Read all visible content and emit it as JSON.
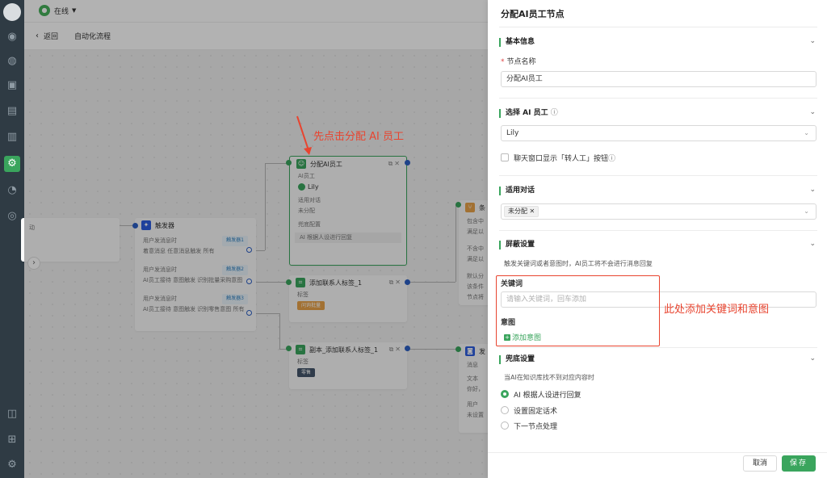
{
  "topbar": {
    "status": "在线"
  },
  "subbar": {
    "back": "返回",
    "breadcrumb": "自动化流程"
  },
  "canvas": {
    "left_node_stub": "动",
    "trigger": {
      "title": "触发器",
      "rows": [
        {
          "event": "用户发消息时",
          "tag": "触发器1",
          "detail": "着意消息  任意消息触发  所有"
        },
        {
          "event": "用户发消息时",
          "tag": "触发器2",
          "detail": "AI员工接待  意图触发  识别批量采购意图"
        },
        {
          "event": "用户发消息时",
          "tag": "触发器3",
          "detail": "AI员工接待  意图触发  识别零售意图  所有"
        }
      ]
    },
    "assign_node": {
      "title": "分配AI员工",
      "ai_label": "AI员工",
      "ai_value": "Lily",
      "scope_label": "适用对话",
      "scope_value": "未分配",
      "fallback_label": "兜底配置",
      "fallback_value": "AI 根据人设进行回复"
    },
    "tag_node_1": {
      "title": "添加联系人标签_1",
      "label": "标签",
      "tag": "问询批量"
    },
    "tag_node_2": {
      "title": "副本_添加联系人标签_1",
      "label": "标签",
      "tag": "零售"
    },
    "cond_node": {
      "title": "条",
      "rows": [
        "包含中",
        "满足以",
        "不含中",
        "满足以",
        "默认分",
        "该条件",
        "节点将"
      ]
    },
    "reply_node": {
      "title": "发",
      "rows": [
        "消息",
        "文本",
        "你好，",
        "用户",
        "未设置"
      ]
    }
  },
  "panel": {
    "title": "分配AI员工节点",
    "basic": {
      "title": "基本信息",
      "name_label": "节点名称",
      "name_value": "分配AI员工"
    },
    "select_ai": {
      "title": "选择 AI 员工",
      "value": "Lily",
      "checkbox_label": "聊天窗口显示「转人工」按钮"
    },
    "scope": {
      "title": "适用对话",
      "chip": "未分配"
    },
    "block": {
      "title": "屏蔽设置",
      "desc": "触发关键词或者意图时，AI员工将不会进行消息回复",
      "keyword_label": "关键词",
      "keyword_placeholder": "请输入关键词，回车添加",
      "intent_label": "意图",
      "add_intent": "添加意图"
    },
    "fallback": {
      "title": "兜底设置",
      "desc": "当AI在知识库找不到对应内容时",
      "options": [
        "AI 根据人设进行回复",
        "设置固定话术",
        "下一节点处理"
      ]
    },
    "footer": {
      "cancel": "取消",
      "save": "保存"
    }
  },
  "annotations": {
    "top": "先点击分配 AI 员工",
    "right": "此处添加关键词和意图"
  },
  "colors": {
    "accent": "#3aa55d",
    "annotation": "#e8442f",
    "sidebar": "#2f3b44"
  }
}
